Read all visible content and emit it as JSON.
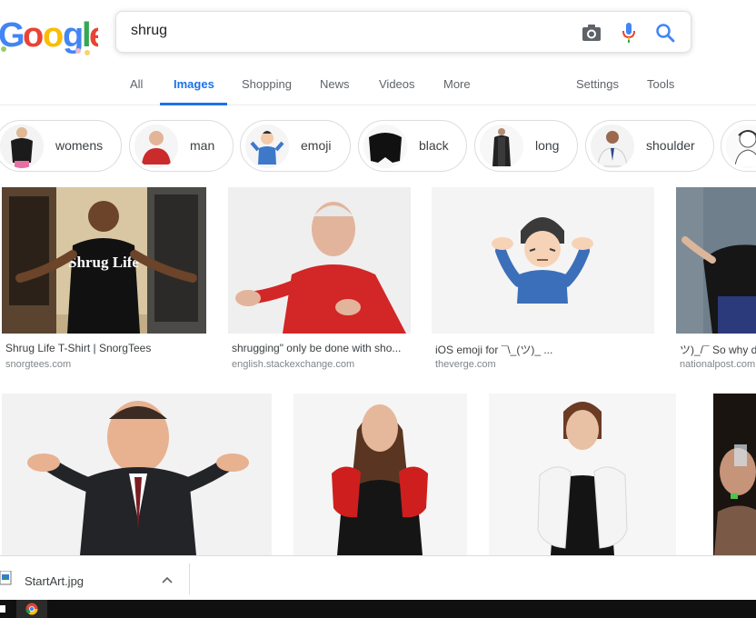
{
  "search": {
    "query": "shrug"
  },
  "tabs": {
    "all": "All",
    "images": "Images",
    "shopping": "Shopping",
    "news": "News",
    "videos": "Videos",
    "more": "More",
    "settings": "Settings",
    "tools": "Tools"
  },
  "chips": [
    {
      "label": "womens"
    },
    {
      "label": "man"
    },
    {
      "label": "emoji"
    },
    {
      "label": "black"
    },
    {
      "label": "long"
    },
    {
      "label": "shoulder"
    }
  ],
  "results": [
    {
      "title": "Shrug Life T-Shirt | SnorgTees",
      "source": "snorgtees.com",
      "shirt_text": "Shrug Life"
    },
    {
      "title": "shrugging\" only be done with sho...",
      "source": "english.stackexchange.com"
    },
    {
      "title": "iOS emoji for ¯\\_(ツ)_ ...",
      "source": "theverge.com"
    },
    {
      "title": "ツ)_/¯ So why d",
      "source": "nationalpost.com"
    }
  ],
  "download": {
    "filename": "StartArt.jpg"
  },
  "colors": {
    "accent": "#1a73e8",
    "tab_inactive": "#5f6368",
    "border": "#dadce0"
  }
}
